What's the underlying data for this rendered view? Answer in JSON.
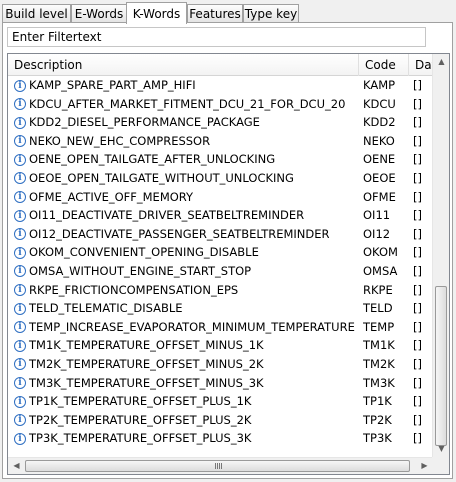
{
  "tabs": [
    {
      "label": "Build level",
      "active": false
    },
    {
      "label": "E-Words",
      "active": false
    },
    {
      "label": "K-Words",
      "active": true
    },
    {
      "label": "Features",
      "active": false
    },
    {
      "label": "Type key",
      "active": false
    }
  ],
  "filter": {
    "value": "Enter Filtertext"
  },
  "table": {
    "columns": [
      "Description",
      "Code",
      "Date"
    ],
    "rows": [
      {
        "description": "KAMP_SPARE_PART_AMP_HIFI",
        "code": "KAMP",
        "date": "[]"
      },
      {
        "description": "KDCU_AFTER_MARKET_FITMENT_DCU_21_FOR_DCU_20",
        "code": "KDCU",
        "date": "[]"
      },
      {
        "description": "KDD2_DIESEL_PERFORMANCE_PACKAGE",
        "code": "KDD2",
        "date": "[]"
      },
      {
        "description": "NEKO_NEW_EHC_COMPRESSOR",
        "code": "NEKO",
        "date": "[]"
      },
      {
        "description": "OENE_OPEN_TAILGATE_AFTER_UNLOCKING",
        "code": "OENE",
        "date": "[]"
      },
      {
        "description": "OEOE_OPEN_TAILGATE_WITHOUT_UNLOCKING",
        "code": "OEOE",
        "date": "[]"
      },
      {
        "description": "OFME_ACTIVE_OFF_MEMORY",
        "code": "OFME",
        "date": "[]"
      },
      {
        "description": "OI11_DEACTIVATE_DRIVER_SEATBELTREMINDER",
        "code": "OI11",
        "date": "[]"
      },
      {
        "description": "OI12_DEACTIVATE_PASSENGER_SEATBELTREMINDER",
        "code": "OI12",
        "date": "[]"
      },
      {
        "description": "OKOM_CONVENIENT_OPENING_DISABLE",
        "code": "OKOM",
        "date": "[]"
      },
      {
        "description": "OMSA_WITHOUT_ENGINE_START_STOP",
        "code": "OMSA",
        "date": "[]"
      },
      {
        "description": "RKPE_FRICTIONCOMPENSATION_EPS",
        "code": "RKPE",
        "date": "[]"
      },
      {
        "description": "TELD_TELEMATIC_DISABLE",
        "code": "TELD",
        "date": "[]"
      },
      {
        "description": "TEMP_INCREASE_EVAPORATOR_MINIMUM_TEMPERATURE",
        "code": "TEMP",
        "date": "[]"
      },
      {
        "description": "TM1K_TEMPERATURE_OFFSET_MINUS_1K",
        "code": "TM1K",
        "date": "[]"
      },
      {
        "description": "TM2K_TEMPERATURE_OFFSET_MINUS_2K",
        "code": "TM2K",
        "date": "[]"
      },
      {
        "description": "TM3K_TEMPERATURE_OFFSET_MINUS_3K",
        "code": "TM3K",
        "date": "[]"
      },
      {
        "description": "TP1K_TEMPERATURE_OFFSET_PLUS_1K",
        "code": "TP1K",
        "date": "[]"
      },
      {
        "description": "TP2K_TEMPERATURE_OFFSET_PLUS_2K",
        "code": "TP2K",
        "date": "[]"
      },
      {
        "description": "TP3K_TEMPERATURE_OFFSET_PLUS_3K",
        "code": "TP3K",
        "date": "[]"
      }
    ]
  },
  "icons": {
    "row_icon": "info-icon"
  }
}
